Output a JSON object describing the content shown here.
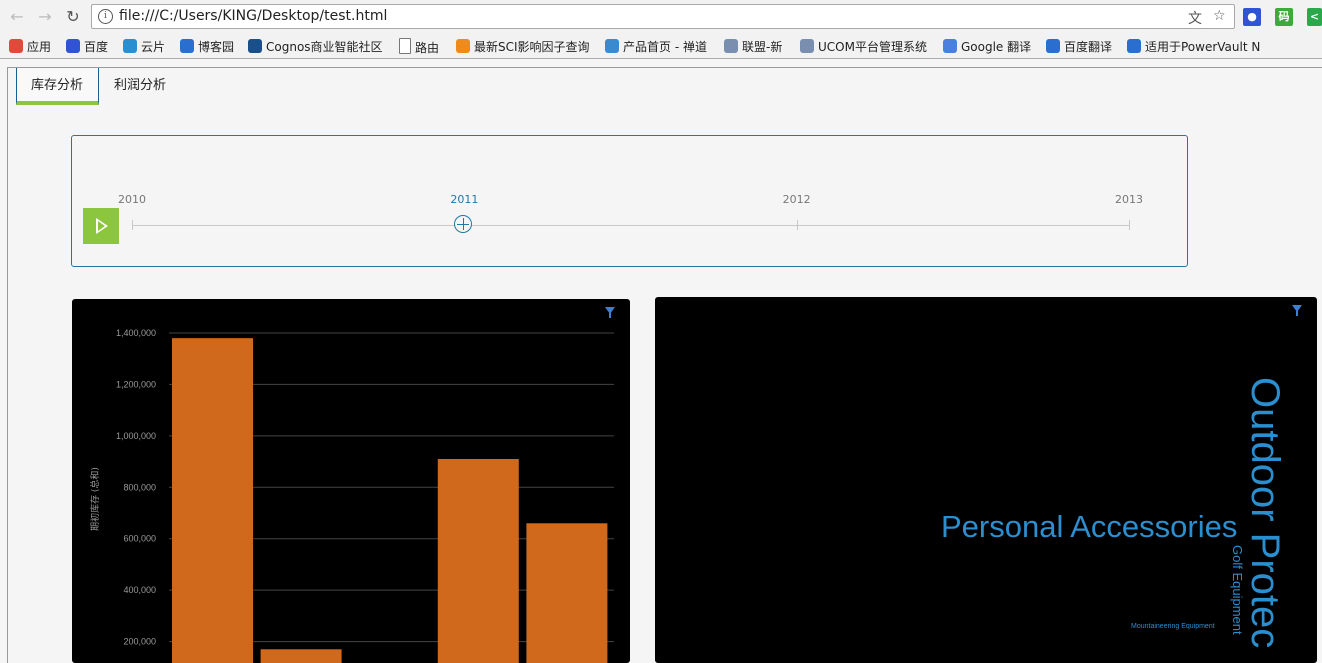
{
  "browser": {
    "url": "file:///C:/Users/KING/Desktop/test.html",
    "bookmarks": [
      {
        "label": "应用",
        "icon": "apps-grid-icon",
        "color": "#e04a3a"
      },
      {
        "label": "百度",
        "icon": "baidu-paw-icon",
        "color": "#2f55d4"
      },
      {
        "label": "云片",
        "icon": "cloud-icon",
        "color": "#2a8fd0"
      },
      {
        "label": "博客园",
        "icon": "blog-icon",
        "color": "#2a6fd0"
      },
      {
        "label": "Cognos商业智能社区",
        "icon": "cognos-icon",
        "color": "#1a4f8a"
      },
      {
        "label": "路由",
        "icon": "page-icon",
        "color": "#ffffff"
      },
      {
        "label": "最新SCI影响因子查询",
        "icon": "p-circle-icon",
        "color": "#f08a1a"
      },
      {
        "label": "产品首页 - 禅道",
        "icon": "globe-icon",
        "color": "#3a8ad0"
      },
      {
        "label": "联盟-新",
        "icon": "globe-icon",
        "color": "#7a8fb0"
      },
      {
        "label": "UCOM平台管理系统",
        "icon": "globe-icon",
        "color": "#7a8fb0"
      },
      {
        "label": "Google 翻译",
        "icon": "google-translate-icon",
        "color": "#4a7fe0"
      },
      {
        "label": "百度翻译",
        "icon": "translate-icon",
        "color": "#2a6fd0"
      },
      {
        "label": "适用于PowerVault N",
        "icon": "dell-icon",
        "color": "#2a6fd0"
      }
    ]
  },
  "tabs": [
    {
      "label": "库存分析",
      "active": true
    },
    {
      "label": "利润分析",
      "active": false
    }
  ],
  "timeline": {
    "years": [
      "2010",
      "2011",
      "2012",
      "2013"
    ],
    "selected": "2011",
    "accent": "#1f78a8",
    "play_color": "#8cc63f"
  },
  "chart_data": {
    "type": "bar",
    "ylabel": "期初库存 (总和)",
    "ylim": [
      0,
      1400000
    ],
    "yticks": [
      "1,400,000",
      "1,200,000",
      "1,000,000",
      "800,000",
      "600,000",
      "400,000",
      "200,000"
    ],
    "categories": [
      "",
      "",
      "",
      "",
      ""
    ],
    "values": [
      1380000,
      170000,
      0,
      910000,
      660000
    ],
    "bar_color": "#d0691c",
    "grid": true
  },
  "word_cloud": {
    "words": [
      {
        "text": "Outdoor Protec",
        "weight": 5
      },
      {
        "text": "Personal Accessories",
        "weight": 4
      },
      {
        "text": "Golf Equipment",
        "weight": 2
      },
      {
        "text": "Mountaineering Equipment",
        "weight": 1
      }
    ],
    "color": "#2a8fd0"
  }
}
